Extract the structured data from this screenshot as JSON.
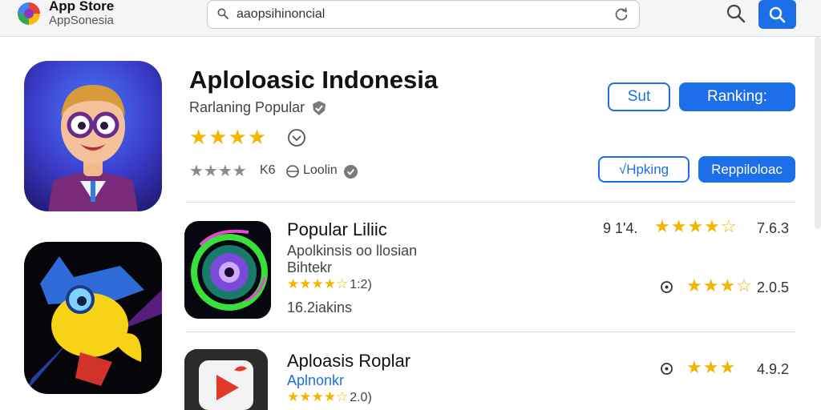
{
  "topbar": {
    "app_name": "App Store",
    "app_sub": "AppSonesia",
    "search_value": "aaopsihinoncial",
    "icons": [
      "store-logo",
      "search-icon",
      "refresh-icon",
      "search-button-icon"
    ]
  },
  "featured": {
    "title": "Aploloasic Indonesia",
    "subtitle": "Rarlaning Popular",
    "stars": "★★★★",
    "grey_stars": "★★★★",
    "grey_count": "K6",
    "grey_label": "Loolin",
    "buttons": {
      "sort": "Sut",
      "ranking": "Ranking:",
      "hpking": "√Hpking",
      "popular": "Reppiloloac"
    }
  },
  "rows": [
    {
      "title": "Popular Liliic",
      "sub1": "Apolkinsis oo llosian",
      "sub2": "Bihtekr",
      "stars": "★★★★☆",
      "rating": "1:2)",
      "meta": "16.2iakins",
      "stat_a": "9 1'4.",
      "stat_stars": "★★★★☆",
      "stat_b": "7.6.3",
      "stat_stars_2": "★★★☆",
      "stat_c": "2.0.5"
    },
    {
      "title": "Aploasis Roplar",
      "sub_blue": "Aplnonkr",
      "stars": "★★★★☆",
      "rating": "2.0)",
      "stat_stars": "★★★",
      "stat_c": "4.9.2"
    }
  ],
  "colors": {
    "accent": "#1c6fe8",
    "star": "#f5b400"
  }
}
